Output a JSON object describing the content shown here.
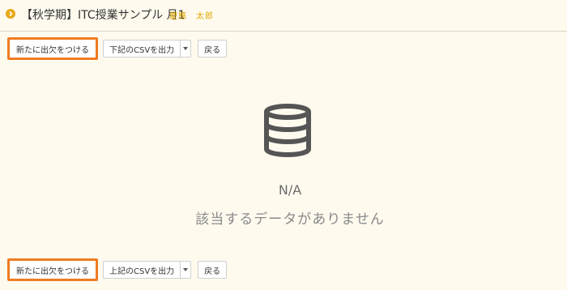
{
  "header": {
    "title": "【秋学期】ITC授業サンプル 月1",
    "author": "慶應　太郎",
    "bullet_icon": "chevron-right-circle-icon",
    "accent_color": "#e6a817"
  },
  "toolbar_top": {
    "new_attendance_label": "新たに出欠をつける",
    "csv_label": "下記のCSVを出力",
    "back_label": "戻る"
  },
  "empty_state": {
    "icon": "database-icon",
    "na_text": "N/A",
    "message": "該当するデータがありません"
  },
  "toolbar_bottom": {
    "new_attendance_label": "新たに出欠をつける",
    "csv_label": "上記のCSVを出力",
    "back_label": "戻る"
  },
  "highlight_color": "#f07b22"
}
